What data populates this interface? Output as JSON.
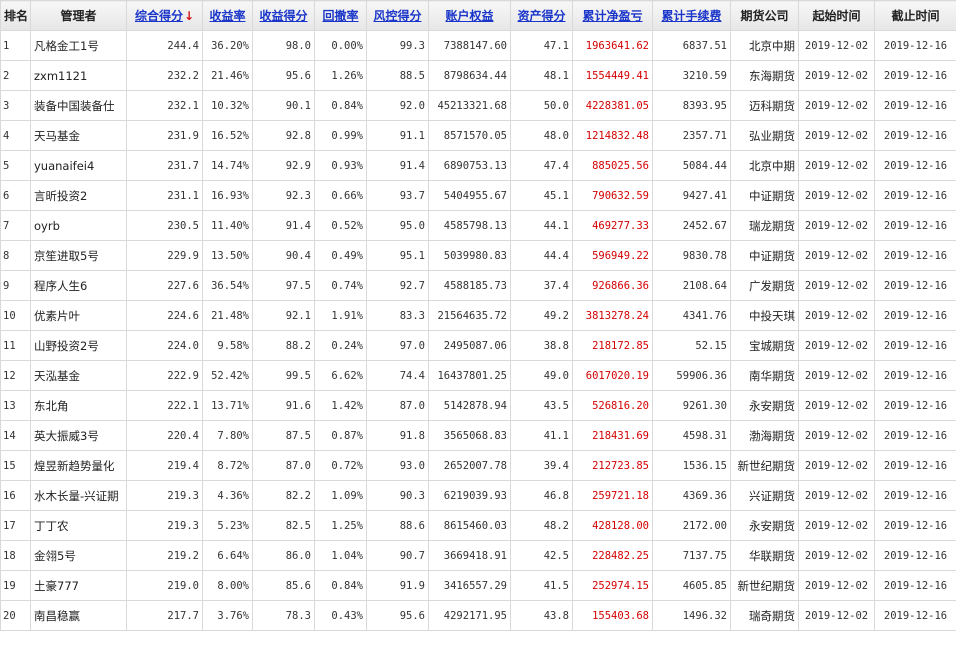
{
  "headers": [
    "排名",
    "管理者",
    "综合得分",
    "收益率",
    "收益得分",
    "回撤率",
    "风控得分",
    "账户权益",
    "资产得分",
    "累计净盈亏",
    "累计手续费",
    "期货公司",
    "起始时间",
    "截止时间"
  ],
  "sort_arrow": "↓",
  "colors": {
    "link": "#1a35c9",
    "profit": "#d40000",
    "arrow": "#d41414"
  },
  "rows": [
    [
      "1",
      "凡格金工1号",
      "244.4",
      "36.20%",
      "98.0",
      "0.00%",
      "99.3",
      "7388147.60",
      "47.1",
      "1963641.62",
      "6837.51",
      "北京中期",
      "2019-12-02",
      "2019-12-16"
    ],
    [
      "2",
      "zxm1121",
      "232.2",
      "21.46%",
      "95.6",
      "1.26%",
      "88.5",
      "8798634.44",
      "48.1",
      "1554449.41",
      "3210.59",
      "东海期货",
      "2019-12-02",
      "2019-12-16"
    ],
    [
      "3",
      "装备中国装备仕",
      "232.1",
      "10.32%",
      "90.1",
      "0.84%",
      "92.0",
      "45213321.68",
      "50.0",
      "4228381.05",
      "8393.95",
      "迈科期货",
      "2019-12-02",
      "2019-12-16"
    ],
    [
      "4",
      "天马基金",
      "231.9",
      "16.52%",
      "92.8",
      "0.99%",
      "91.1",
      "8571570.05",
      "48.0",
      "1214832.48",
      "2357.71",
      "弘业期货",
      "2019-12-02",
      "2019-12-16"
    ],
    [
      "5",
      "yuanaifei4",
      "231.7",
      "14.74%",
      "92.9",
      "0.93%",
      "91.4",
      "6890753.13",
      "47.4",
      "885025.56",
      "5084.44",
      "北京中期",
      "2019-12-02",
      "2019-12-16"
    ],
    [
      "6",
      "言昕投资2",
      "231.1",
      "16.93%",
      "92.3",
      "0.66%",
      "93.7",
      "5404955.67",
      "45.1",
      "790632.59",
      "9427.41",
      "中证期货",
      "2019-12-02",
      "2019-12-16"
    ],
    [
      "7",
      "oyrb",
      "230.5",
      "11.40%",
      "91.4",
      "0.52%",
      "95.0",
      "4585798.13",
      "44.1",
      "469277.33",
      "2452.67",
      "瑞龙期货",
      "2019-12-02",
      "2019-12-16"
    ],
    [
      "8",
      "京笙进取5号",
      "229.9",
      "13.50%",
      "90.4",
      "0.49%",
      "95.1",
      "5039980.83",
      "44.4",
      "596949.22",
      "9830.78",
      "中证期货",
      "2019-12-02",
      "2019-12-16"
    ],
    [
      "9",
      "程序人生6",
      "227.6",
      "36.54%",
      "97.5",
      "0.74%",
      "92.7",
      "4588185.73",
      "37.4",
      "926866.36",
      "2108.64",
      "广发期货",
      "2019-12-02",
      "2019-12-16"
    ],
    [
      "10",
      "优素片叶",
      "224.6",
      "21.48%",
      "92.1",
      "1.91%",
      "83.3",
      "21564635.72",
      "49.2",
      "3813278.24",
      "4341.76",
      "中投天琪",
      "2019-12-02",
      "2019-12-16"
    ],
    [
      "11",
      "山野投资2号",
      "224.0",
      "9.58%",
      "88.2",
      "0.24%",
      "97.0",
      "2495087.06",
      "38.8",
      "218172.85",
      "52.15",
      "宝城期货",
      "2019-12-02",
      "2019-12-16"
    ],
    [
      "12",
      "天泓基金",
      "222.9",
      "52.42%",
      "99.5",
      "6.62%",
      "74.4",
      "16437801.25",
      "49.0",
      "6017020.19",
      "59906.36",
      "南华期货",
      "2019-12-02",
      "2019-12-16"
    ],
    [
      "13",
      "东北角",
      "222.1",
      "13.71%",
      "91.6",
      "1.42%",
      "87.0",
      "5142878.94",
      "43.5",
      "526816.20",
      "9261.30",
      "永安期货",
      "2019-12-02",
      "2019-12-16"
    ],
    [
      "14",
      "英大振威3号",
      "220.4",
      "7.80%",
      "87.5",
      "0.87%",
      "91.8",
      "3565068.83",
      "41.1",
      "218431.69",
      "4598.31",
      "渤海期货",
      "2019-12-02",
      "2019-12-16"
    ],
    [
      "15",
      "煌昱新趋势量化",
      "219.4",
      "8.72%",
      "87.0",
      "0.72%",
      "93.0",
      "2652007.78",
      "39.4",
      "212723.85",
      "1536.15",
      "新世纪期货",
      "2019-12-02",
      "2019-12-16"
    ],
    [
      "16",
      "水木长量-兴证期",
      "219.3",
      "4.36%",
      "82.2",
      "1.09%",
      "90.3",
      "6219039.93",
      "46.8",
      "259721.18",
      "4369.36",
      "兴证期货",
      "2019-12-02",
      "2019-12-16"
    ],
    [
      "17",
      "丁丁农",
      "219.3",
      "5.23%",
      "82.5",
      "1.25%",
      "88.6",
      "8615460.03",
      "48.2",
      "428128.00",
      "2172.00",
      "永安期货",
      "2019-12-02",
      "2019-12-16"
    ],
    [
      "18",
      "金翎5号",
      "219.2",
      "6.64%",
      "86.0",
      "1.04%",
      "90.7",
      "3669418.91",
      "42.5",
      "228482.25",
      "7137.75",
      "华联期货",
      "2019-12-02",
      "2019-12-16"
    ],
    [
      "19",
      "土豪777",
      "219.0",
      "8.00%",
      "85.6",
      "0.84%",
      "91.9",
      "3416557.29",
      "41.5",
      "252974.15",
      "4605.85",
      "新世纪期货",
      "2019-12-02",
      "2019-12-16"
    ],
    [
      "20",
      "南昌稳赢",
      "217.7",
      "3.76%",
      "78.3",
      "0.43%",
      "95.6",
      "4292171.95",
      "43.8",
      "155403.68",
      "1496.32",
      "瑞奇期货",
      "2019-12-02",
      "2019-12-16"
    ]
  ]
}
